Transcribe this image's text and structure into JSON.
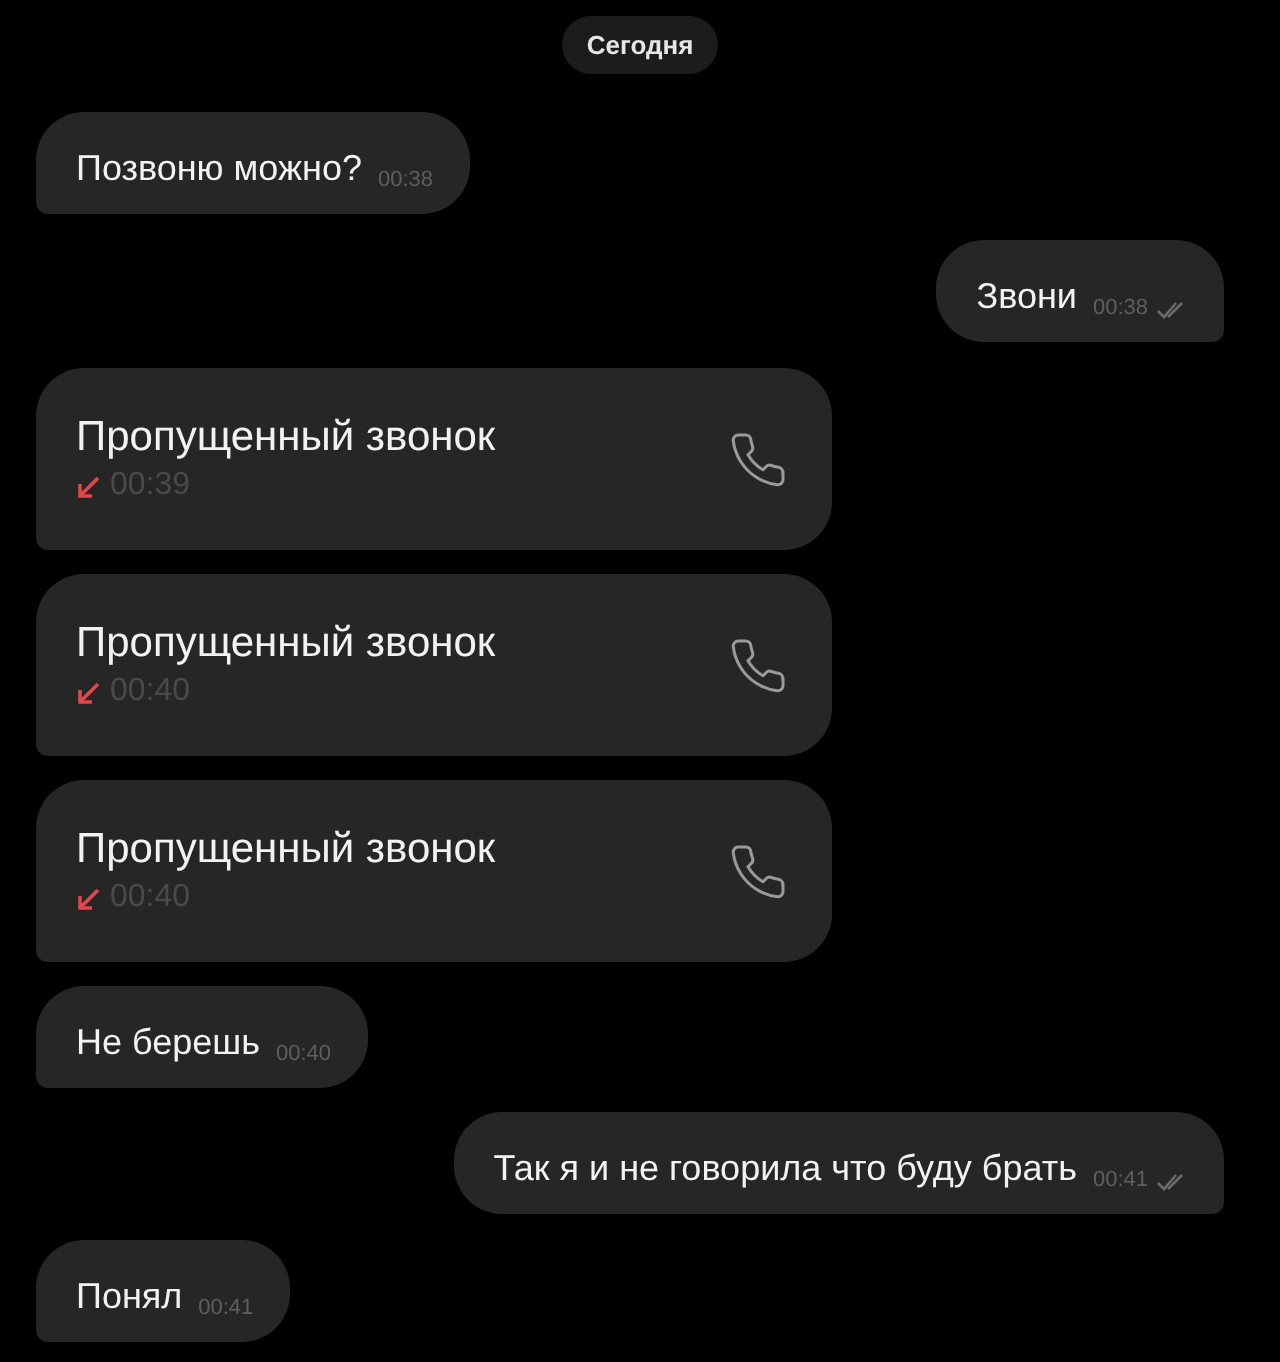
{
  "date_label": "Сегодня",
  "messages": [
    {
      "kind": "text",
      "outgoing": false,
      "text": "Позвоню можно?",
      "time": "00:38"
    },
    {
      "kind": "text",
      "outgoing": true,
      "text": "Звони",
      "time": "00:38",
      "read": true
    },
    {
      "kind": "call",
      "outgoing": false,
      "text": "Пропущенный звонок",
      "time": "00:39",
      "missed": true
    },
    {
      "kind": "call",
      "outgoing": false,
      "text": "Пропущенный звонок",
      "time": "00:40",
      "missed": true
    },
    {
      "kind": "call",
      "outgoing": false,
      "text": "Пропущенный звонок",
      "time": "00:40",
      "missed": true
    },
    {
      "kind": "text",
      "outgoing": false,
      "text": "Не берешь",
      "time": "00:40"
    },
    {
      "kind": "text",
      "outgoing": true,
      "text": "Так я и не говорила что буду брать",
      "time": "00:41",
      "read": true
    },
    {
      "kind": "text",
      "outgoing": false,
      "text": "Понял",
      "time": "00:41"
    }
  ]
}
